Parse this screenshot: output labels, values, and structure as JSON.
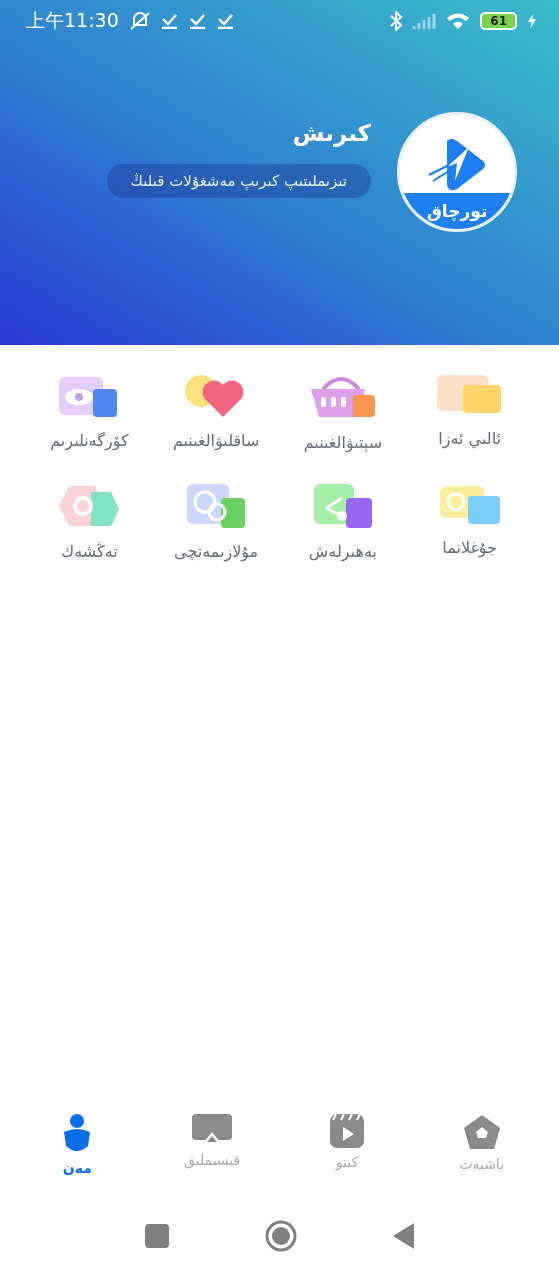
{
  "status_bar": {
    "time": "上午11:30",
    "battery": "61"
  },
  "profile": {
    "title": "كىرىش",
    "subtitle": "تىزىملىتىپ كىرىپ مەشغۇلات قىلىڭ",
    "logo_text": "تورچاق"
  },
  "menu_items": [
    {
      "label": "ئالىي ئەزا"
    },
    {
      "label": "سېتىۋالغىنىم"
    },
    {
      "label": "ساقلىۋالغىنىم"
    },
    {
      "label": "كۆرگەنلىرىم"
    },
    {
      "label": "جۇغلانما"
    },
    {
      "label": "بەھىرلەش"
    },
    {
      "label": "مۇلازىمەتچى"
    },
    {
      "label": "تەڭشەك"
    }
  ],
  "tabs": [
    {
      "label": "باشبەت",
      "selected": false
    },
    {
      "label": "كىنو",
      "selected": false
    },
    {
      "label": "قىسىملىق",
      "selected": false
    },
    {
      "label": "مەن",
      "selected": true
    }
  ]
}
